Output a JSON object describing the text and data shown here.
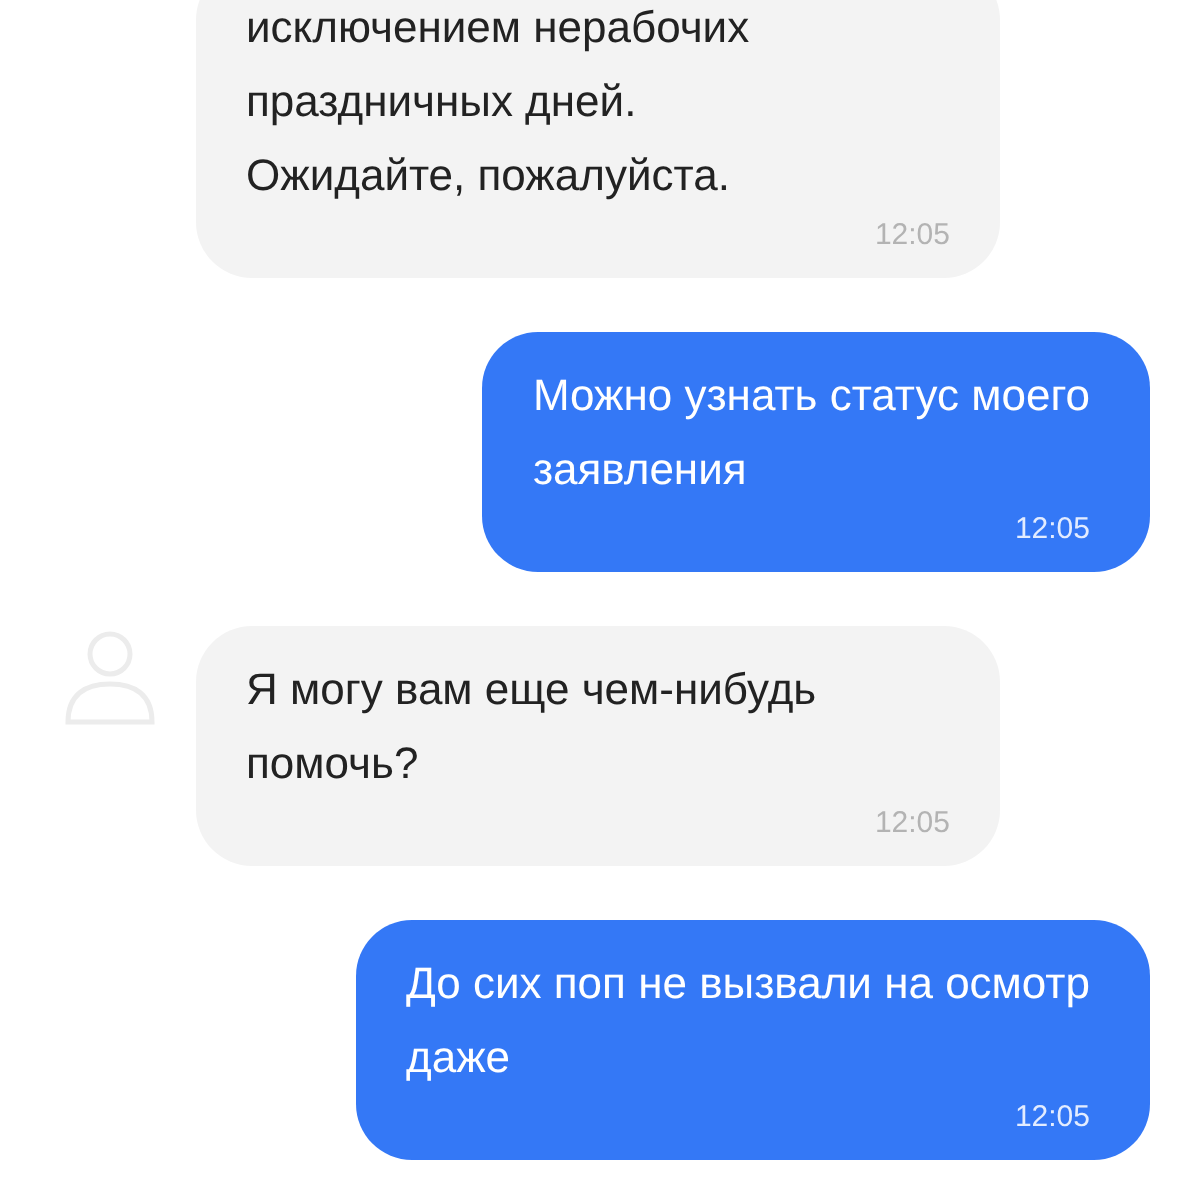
{
  "messages": [
    {
      "kind": "incoming",
      "show_avatar": false,
      "text": "исключением нерабочих\nпраздничных дней.\nОжидайте, пожалуйста.",
      "time": "12:05"
    },
    {
      "kind": "outgoing",
      "text": "Можно узнать статус моего\nзаявления",
      "time": "12:05"
    },
    {
      "kind": "incoming",
      "show_avatar": true,
      "text": "Я могу вам еще чем-нибудь\nпомочь?",
      "time": "12:05"
    },
    {
      "kind": "outgoing",
      "text": "До сих поп не вызвали на осмотр\nдаже",
      "time": "12:05"
    }
  ]
}
